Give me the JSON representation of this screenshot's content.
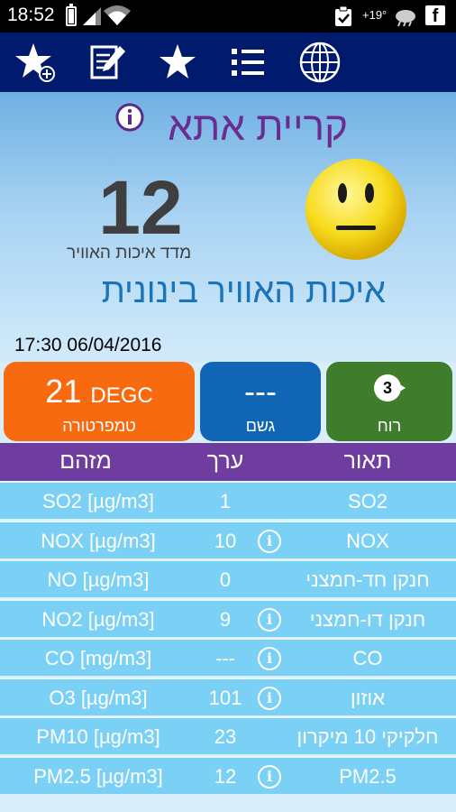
{
  "statusbar": {
    "time": "18:52",
    "temperature": "+19°"
  },
  "toolbar": {
    "icons": [
      "star-add-icon",
      "edit-note-icon",
      "star-icon",
      "list-icon",
      "globe-icon"
    ]
  },
  "header": {
    "city": "קריית אתא",
    "aqi_value": "12",
    "aqi_label": "מדד איכות האוויר",
    "status": "איכות האוויר בינונית",
    "datetime": "17:30 06/04/2016"
  },
  "tiles": {
    "temperature": {
      "value": "21",
      "unit": "DEGC",
      "label": "טמפרטורה"
    },
    "rain": {
      "value": "---",
      "label": "גשם"
    },
    "wind": {
      "value": "3",
      "label": "רוח"
    }
  },
  "table": {
    "headers": {
      "pollutant": "מזהם",
      "value": "ערך",
      "description": "תאור"
    },
    "rows": [
      {
        "unit": "SO2 [µg/m3]",
        "value": "1",
        "info": false,
        "desc": "SO2"
      },
      {
        "unit": "NOX [µg/m3]",
        "value": "10",
        "info": true,
        "desc": "NOX"
      },
      {
        "unit": "NO [µg/m3]",
        "value": "0",
        "info": false,
        "desc": "חנקן חד-חמצני"
      },
      {
        "unit": "NO2 [µg/m3]",
        "value": "9",
        "info": true,
        "desc": "חנקן דו-חמצני"
      },
      {
        "unit": "CO [mg/m3]",
        "value": "---",
        "info": true,
        "desc": "CO"
      },
      {
        "unit": "O3 [µg/m3]",
        "value": "101",
        "info": true,
        "desc": "אוזון"
      },
      {
        "unit": "PM10 [µg/m3]",
        "value": "23",
        "info": false,
        "desc": "חלקיקי 10 מיקרון"
      },
      {
        "unit": "PM2.5 [µg/m3]",
        "value": "12",
        "info": true,
        "desc": "PM2.5"
      }
    ]
  },
  "colors": {
    "toolbar": "#001a6e",
    "city": "#6a2c8f",
    "status": "#1b74b8",
    "temp_tile": "#f86a10",
    "rain_tile": "#1066b5",
    "wind_tile": "#3f7c2b",
    "table_header": "#6f3c9f",
    "table_row": "#7ad0f5"
  }
}
